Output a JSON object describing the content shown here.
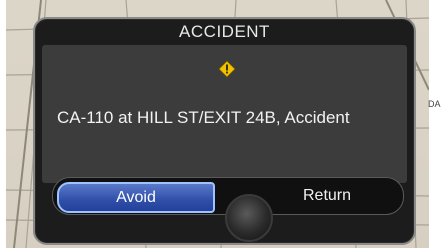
{
  "dialog": {
    "title": "ACCIDENT",
    "message": "CA-110 at HILL ST/EXIT 24B, Accident",
    "icon": "warning-diamond-icon"
  },
  "buttons": {
    "avoid_label": "Avoid",
    "return_label": "Return"
  },
  "map": {
    "edge_label": "DAD"
  },
  "colors": {
    "dialog_bg": "#1c1c1c",
    "panel_bg": "#3c3c3c",
    "avoid_button": "#2f4fa9",
    "warning_yellow": "#f2c200",
    "map_bg": "#d7d0c2"
  }
}
